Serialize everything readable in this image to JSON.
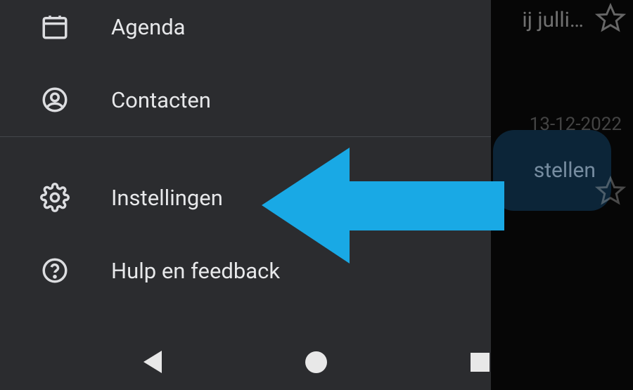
{
  "drawer": {
    "items": [
      {
        "label": "Agenda",
        "icon": "calendar-icon"
      },
      {
        "label": "Contacten",
        "icon": "account-circle-icon"
      },
      {
        "label": "Instellingen",
        "icon": "gear-icon"
      },
      {
        "label": "Hulp en feedback",
        "icon": "help-icon"
      }
    ]
  },
  "behind": {
    "snippet": "ij julli…",
    "date": "13-12-2022",
    "compose": "stellen"
  },
  "arrow_color": "#19a9e5"
}
